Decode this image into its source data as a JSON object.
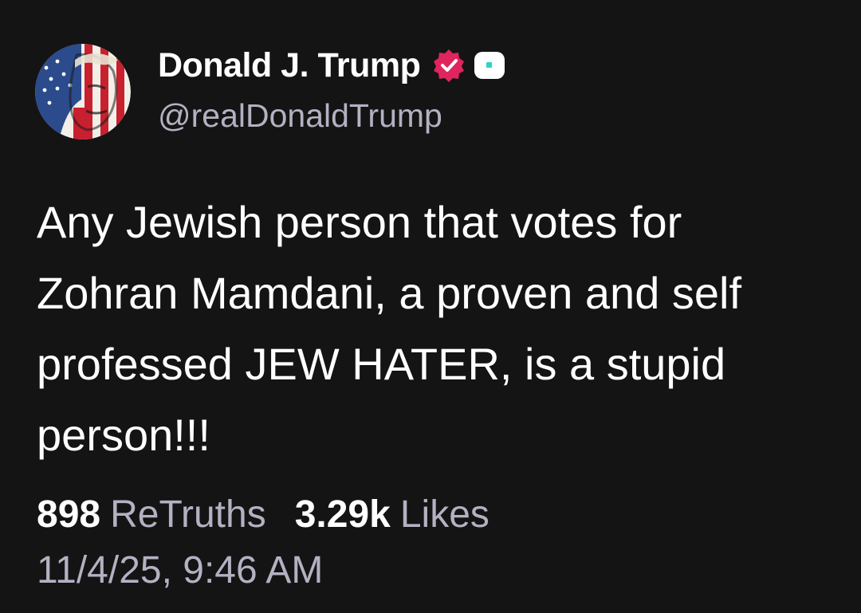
{
  "author": {
    "display_name": "Donald J. Trump",
    "handle": "@realDonaldTrump",
    "avatar_icon": "flag-portrait-avatar",
    "verified_icon": "verified-check-icon",
    "badge_icon": "status-badge-icon"
  },
  "post": {
    "lines": [
      "Any Jewish person that votes for",
      "Zohran Mamdani, a proven and self",
      "professed JEW HATER, is a stupid",
      "person!!!"
    ]
  },
  "stats": {
    "retruths_count": "898",
    "retruths_label": "ReTruths",
    "likes_count": "3.29k",
    "likes_label": "Likes"
  },
  "timestamp": "11/4/25, 9:46 AM",
  "colors": {
    "background": "#141414",
    "primary_text": "#ffffff",
    "secondary_text": "#b3b1c2",
    "verified_badge": "#e0245e",
    "status_badge_dot": "#2fd4c3"
  }
}
